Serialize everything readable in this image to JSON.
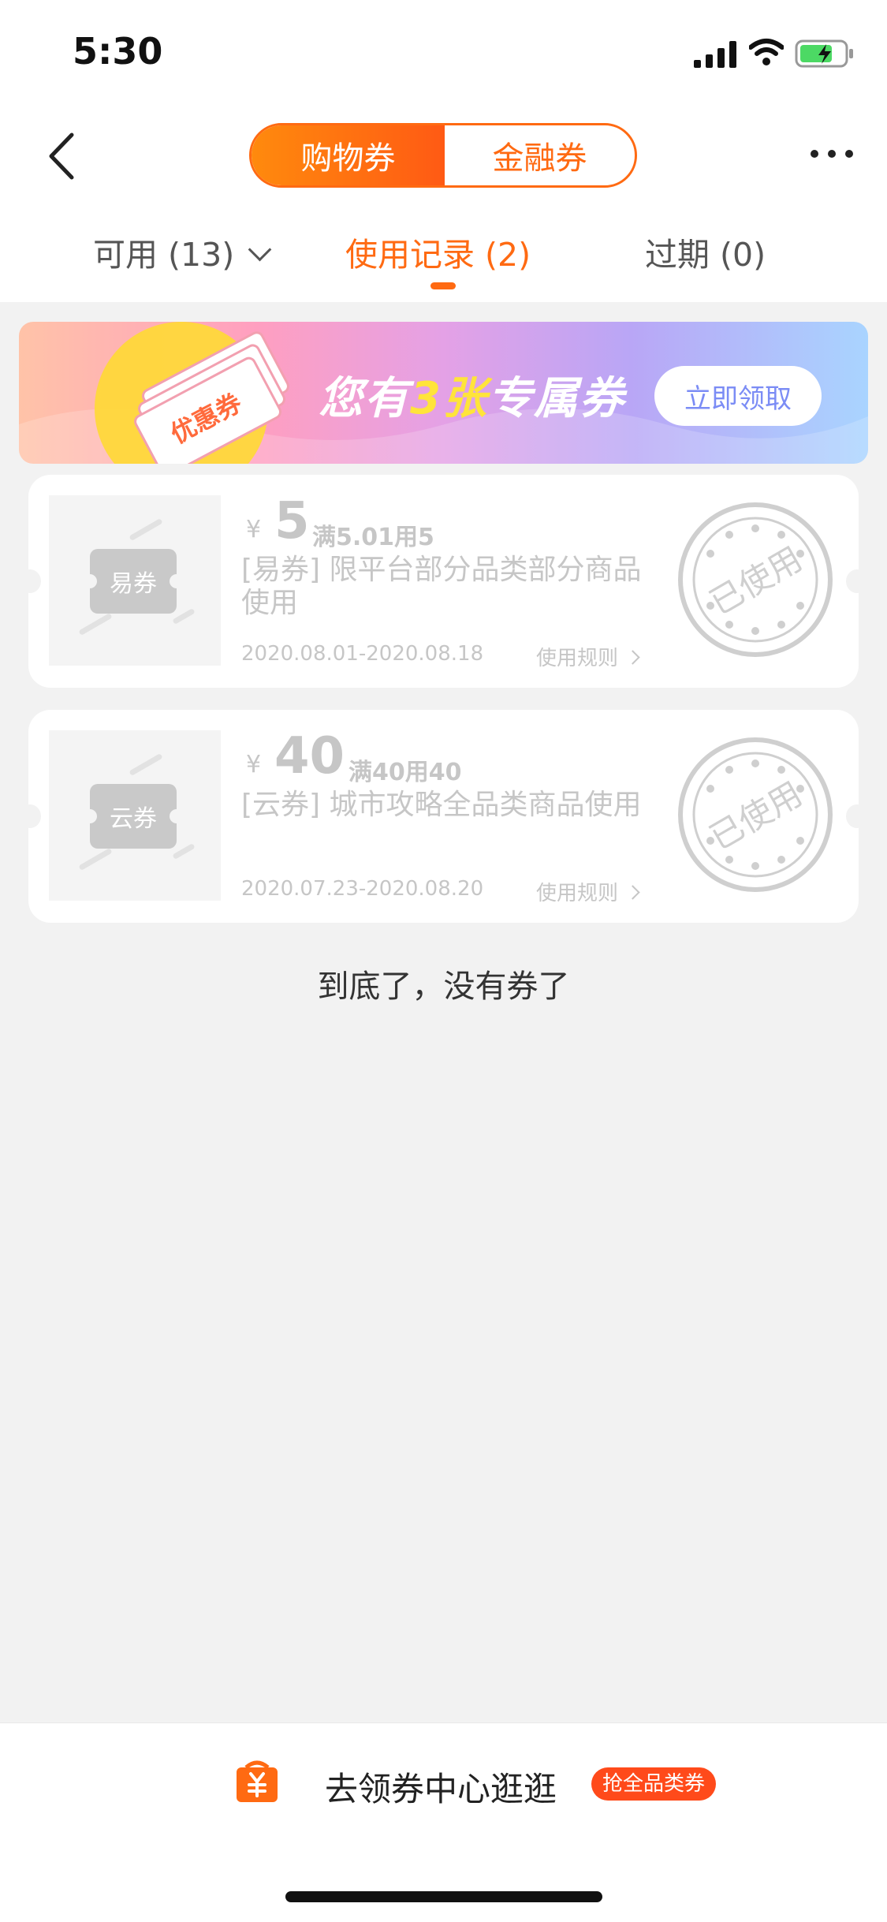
{
  "status_bar": {
    "time": "5:30"
  },
  "header": {
    "segments": [
      {
        "label": "购物券",
        "active": true
      },
      {
        "label": "金融券",
        "active": false
      }
    ]
  },
  "tabs": [
    {
      "label": "可用 (13)",
      "has_dropdown": true
    },
    {
      "label": "使用记录 (2)",
      "active": true
    },
    {
      "label": "过期 (0)"
    }
  ],
  "banner": {
    "ticket_label": "优惠券",
    "text_prefix": "您有",
    "text_highlight": "3张",
    "text_suffix": "专属券",
    "button_label": "立即领取"
  },
  "coupons": [
    {
      "thumb_label": "易券",
      "currency": "¥",
      "amount": "5",
      "condition": "满5.01用5",
      "description": "[易券] 限平台部分品类部分商品使用",
      "date_range": "2020.08.01-2020.08.18",
      "rule_label": "使用规则",
      "stamp_text": "已使用"
    },
    {
      "thumb_label": "云券",
      "currency": "¥",
      "amount": "40",
      "condition": "满40用40",
      "description": "[云券] 城市攻略全品类商品使用",
      "date_range": "2020.07.23-2020.08.20",
      "rule_label": "使用规则",
      "stamp_text": "已使用"
    }
  ],
  "end_message": "到底了，没有券了",
  "bottom_bar": {
    "link_text": "去领券中心逛逛",
    "badge": "抢全品类券"
  },
  "colors": {
    "accent": "#ff6a12",
    "muted": "#c6c6c6",
    "badge": "#ff4a1a"
  }
}
